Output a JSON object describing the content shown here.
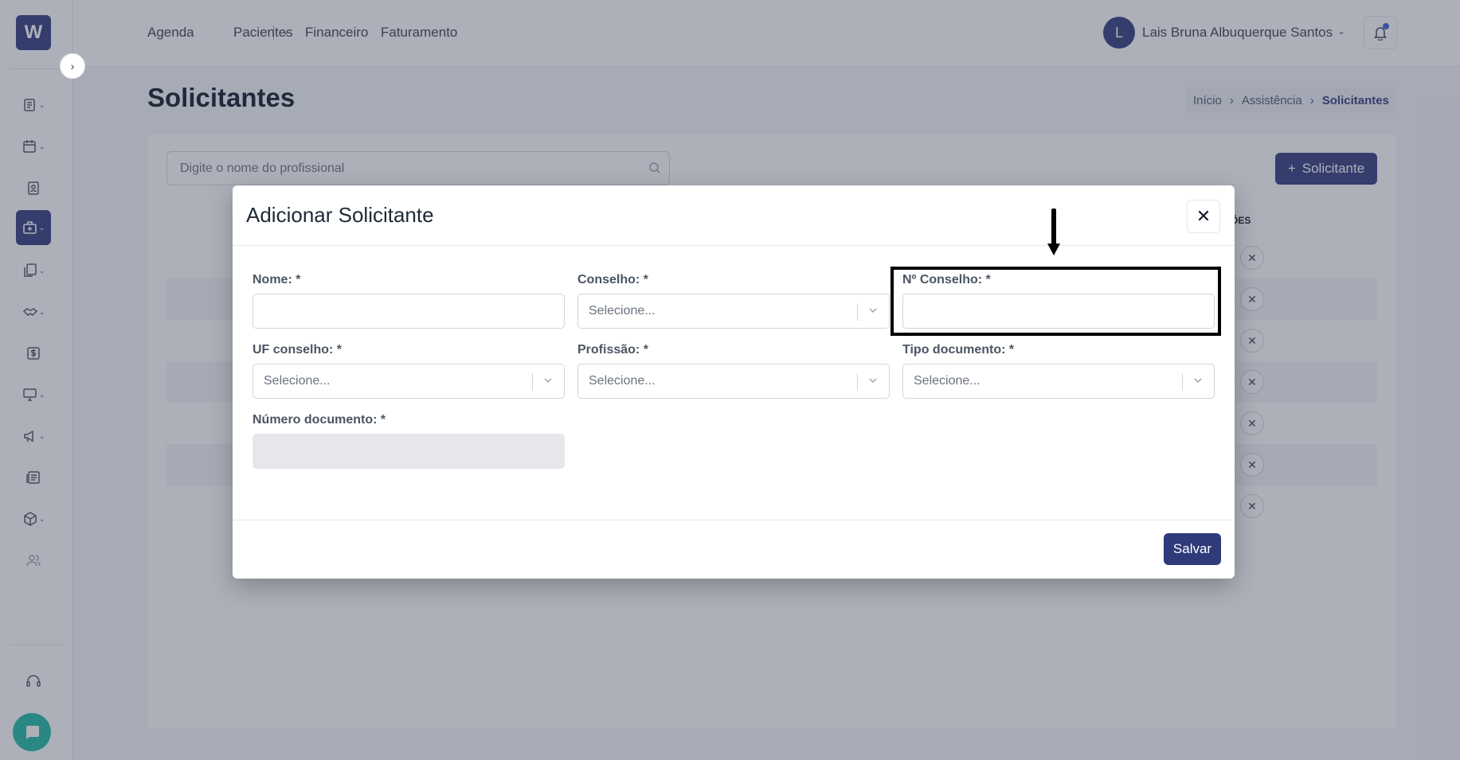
{
  "app": {
    "logo_letter": "W",
    "accent_color": "#2f3a7a"
  },
  "topnav": {
    "links": [
      "Agenda",
      "Pacientes",
      "Financeiro",
      "Faturamento"
    ],
    "user": {
      "initial": "L",
      "name": "Lais Bruna Albuquerque Santos"
    }
  },
  "sidebar": {
    "items": [
      {
        "icon": "clipboard-list-icon",
        "has_submenu": true
      },
      {
        "icon": "calendar-icon",
        "has_submenu": true
      },
      {
        "icon": "id-card-icon",
        "has_submenu": false
      },
      {
        "icon": "medical-bag-icon",
        "has_submenu": true,
        "active": true
      },
      {
        "icon": "documents-icon",
        "has_submenu": true
      },
      {
        "icon": "handshake-icon",
        "has_submenu": true
      },
      {
        "icon": "dollar-icon",
        "has_submenu": false
      },
      {
        "icon": "monitor-icon",
        "has_submenu": true
      },
      {
        "icon": "megaphone-icon",
        "has_submenu": true
      },
      {
        "icon": "report-icon",
        "has_submenu": false
      },
      {
        "icon": "box-icon",
        "has_submenu": true
      },
      {
        "icon": "users-icon",
        "has_submenu": false
      },
      {
        "icon": "headset-icon",
        "has_submenu": false
      }
    ]
  },
  "page": {
    "title": "Solicitantes",
    "breadcrumb": [
      "Início",
      "Assistência",
      "Solicitantes"
    ],
    "search_placeholder": "Digite o nome do profissional",
    "add_button_label": "Solicitante",
    "actions_column_header": "ÕES"
  },
  "modal": {
    "title": "Adicionar Solicitante",
    "fields": {
      "nome": {
        "label": "Nome: *",
        "value": ""
      },
      "conselho": {
        "label": "Conselho: *",
        "placeholder": "Selecione..."
      },
      "num_conselho": {
        "label": "Nº Conselho: *",
        "value": ""
      },
      "uf_conselho": {
        "label": "UF conselho: *",
        "placeholder": "Selecione..."
      },
      "profissao": {
        "label": "Profissão: *",
        "placeholder": "Selecione..."
      },
      "tipo_documento": {
        "label": "Tipo documento: *",
        "placeholder": "Selecione..."
      },
      "numero_documento": {
        "label": "Número documento: *",
        "value": ""
      }
    },
    "save_label": "Salvar"
  }
}
